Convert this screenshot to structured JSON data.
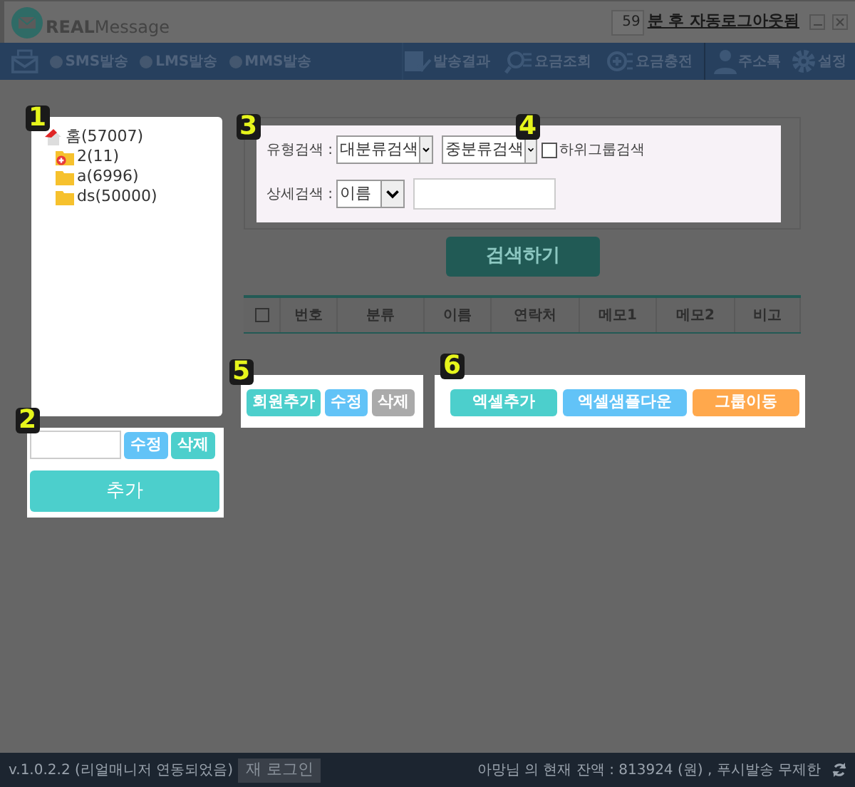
{
  "title_bar": {
    "logo_bold": "REAL",
    "logo_light": "Message",
    "timer": "59",
    "logout_notice": "분 후 자동로그아웃됨"
  },
  "nav": {
    "send_options": [
      {
        "label": "SMS발송",
        "selected": false
      },
      {
        "label": "LMS발송",
        "selected": false
      },
      {
        "label": "MMS발송",
        "selected": false
      }
    ],
    "tools": [
      "발송결과",
      "요금조회",
      "요금충전"
    ],
    "account": [
      "주소록",
      "설정"
    ]
  },
  "callouts": [
    "1",
    "2",
    "3",
    "4",
    "5",
    "6"
  ],
  "group_tree": [
    {
      "label": "홈(57007)",
      "kind": "home",
      "children": [
        {
          "label": "2(11)",
          "kind": "new-folder"
        },
        {
          "label": "a(6996)",
          "kind": "folder"
        },
        {
          "label": "ds(50000)",
          "kind": "folder"
        }
      ]
    }
  ],
  "group_edit": {
    "buttons": [
      {
        "label": "수정",
        "color": "#62c3f7"
      },
      {
        "label": "삭제",
        "color": "#4ccfcc"
      }
    ],
    "add_button": "추가"
  },
  "search": {
    "type_label": "유형검색 :",
    "type_selects": [
      "대분류검색",
      "중분류검색"
    ],
    "subgroup_label": "하위그룹검색",
    "subgroup_checked": false,
    "detail_label": "상세검색 :",
    "detail_select": "이름",
    "search_button": "검색하기"
  },
  "table": {
    "header_checked": false,
    "columns": [
      "번호",
      "분류",
      "이름",
      "연락처",
      "메모1",
      "메모2",
      "비고"
    ]
  },
  "member_buttons": [
    {
      "label": "회원추가",
      "color": "#4ccfcc"
    },
    {
      "label": "수정",
      "color": "#62c3f7"
    },
    {
      "label": "삭제",
      "color": "#aaaaaa"
    }
  ],
  "excel_buttons": [
    {
      "label": "엑셀추가",
      "color": "#4ccfcc"
    },
    {
      "label": "엑셀샘플다운",
      "color": "#62c3f7"
    },
    {
      "label": "그룹이동",
      "color": "#ffa84c"
    }
  ],
  "status_bar": {
    "version": "v.1.0.2.2 (리얼매니저 연동되었음)",
    "relogin": "재 로그인",
    "balance": "아망님 의 현재 잔액 : 813924 (원) , 푸시발송 무제한"
  }
}
